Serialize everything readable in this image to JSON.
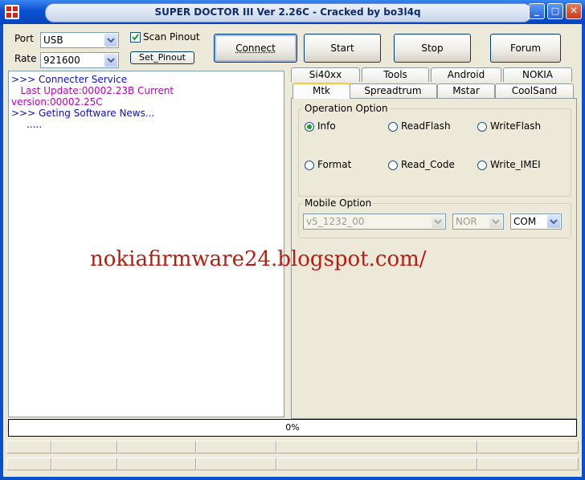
{
  "window": {
    "title": "SUPER DOCTOR III Ver 2.26C - Cracked by bo3l4q",
    "minimize": "_",
    "maximize": "□",
    "close": "✕"
  },
  "connection": {
    "port_label": "Port",
    "port_value": "USB",
    "rate_label": "Rate",
    "rate_value": "921600",
    "scan_pinout_label": "Scan Pinout",
    "scan_pinout_checked": true,
    "set_pinout_label": "Set_Pinout"
  },
  "toolbar": {
    "connect": "Connect",
    "start": "Start",
    "stop": "Stop",
    "forum": "Forum"
  },
  "log": [
    {
      "text": ">>> Connecter Service",
      "color": "#1010c8"
    },
    {
      "text": "   Last Update:00002.23B Current",
      "color": "#c000c0"
    },
    {
      "text": "version:00002.25C",
      "color": "#c000c0"
    },
    {
      "text": ">>> Geting Software News...",
      "color": "#1010c8"
    },
    {
      "text": "     .....",
      "color": "#1010c8"
    }
  ],
  "tabs_row1": [
    "Si40xx",
    "Tools",
    "Android",
    "NOKIA"
  ],
  "tabs_row2": [
    "Mtk",
    "Spreadtrum",
    "Mstar",
    "CoolSand"
  ],
  "active_tab": "Mtk",
  "operation": {
    "title": "Operation Option",
    "options": [
      "Info",
      "ReadFlash",
      "WriteFlash",
      "Format",
      "Read_Code",
      "Write_IMEI"
    ],
    "selected": "Info"
  },
  "mobile": {
    "title": "Mobile Option",
    "version_value": "v5_1232_00",
    "flash_value": "NOR",
    "port_value": "COM"
  },
  "watermark": "nokiafirmware24.blogspot.com/",
  "progress": {
    "value": 0,
    "text": "0%"
  },
  "colors": {
    "titlebar": "#0a4fd0",
    "client": "#ece9d8",
    "watermark": "#b51d12",
    "radio_dot": "#21a121"
  }
}
